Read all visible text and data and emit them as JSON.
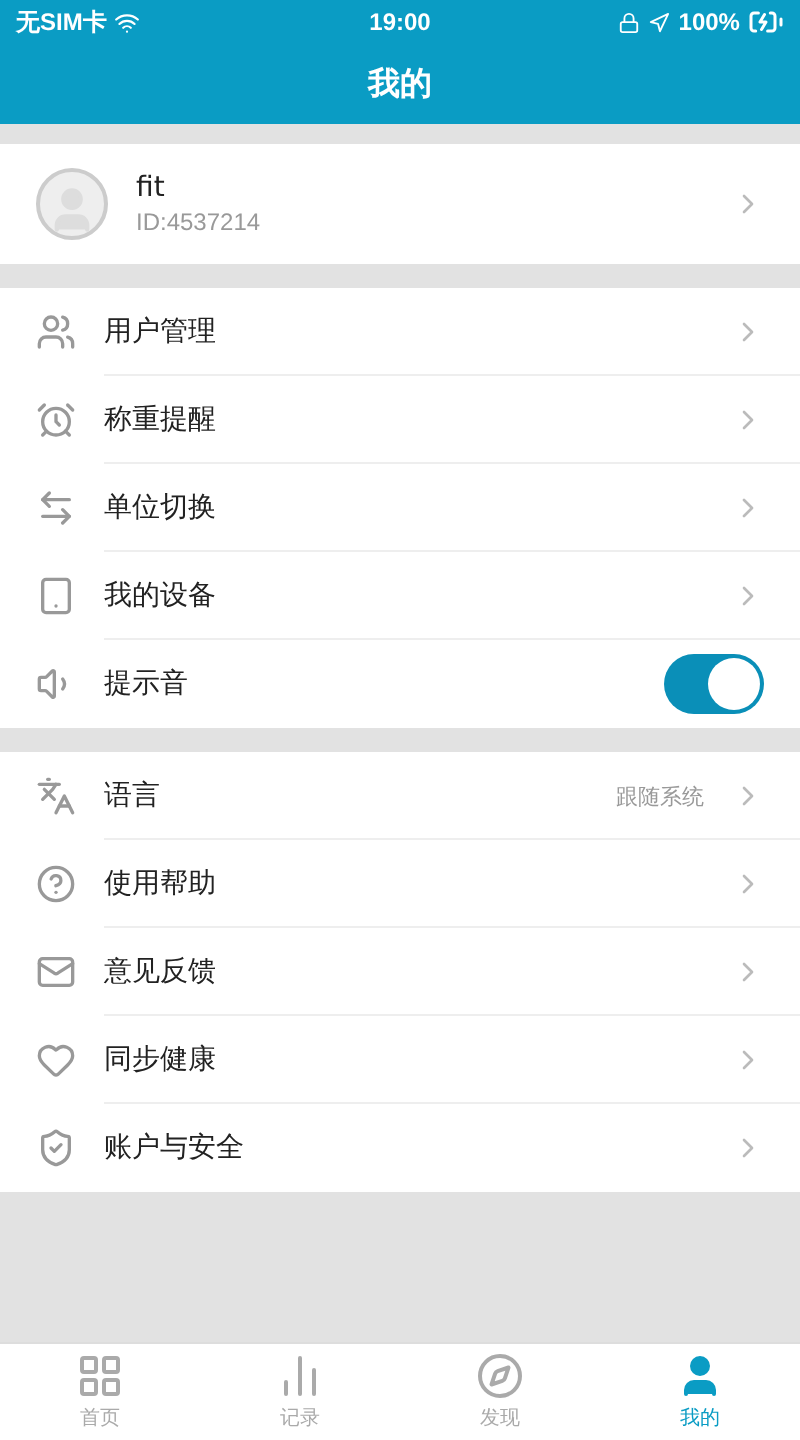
{
  "status_bar": {
    "carrier": "无SIM卡",
    "time": "19:00",
    "battery": "100%"
  },
  "nav": {
    "title": "我的"
  },
  "profile": {
    "name": "fit",
    "id": "ID:4537214"
  },
  "sections": [
    {
      "rows": [
        {
          "kind": "link",
          "label": "用户管理"
        },
        {
          "kind": "link",
          "label": "称重提醒"
        },
        {
          "kind": "link",
          "label": "单位切换"
        },
        {
          "kind": "link",
          "label": "我的设备"
        },
        {
          "kind": "toggle",
          "label": "提示音",
          "on": true
        }
      ]
    },
    {
      "rows": [
        {
          "kind": "link",
          "label": "语言",
          "value": "跟随系统"
        },
        {
          "kind": "link",
          "label": "使用帮助"
        },
        {
          "kind": "link",
          "label": "意见反馈"
        },
        {
          "kind": "link",
          "label": "同步健康"
        },
        {
          "kind": "link",
          "label": "账户与安全"
        }
      ]
    }
  ],
  "tabs": [
    {
      "label": "首页",
      "selected": false
    },
    {
      "label": "记录",
      "selected": false
    },
    {
      "label": "发现",
      "selected": false
    },
    {
      "label": "我的",
      "selected": true
    }
  ]
}
